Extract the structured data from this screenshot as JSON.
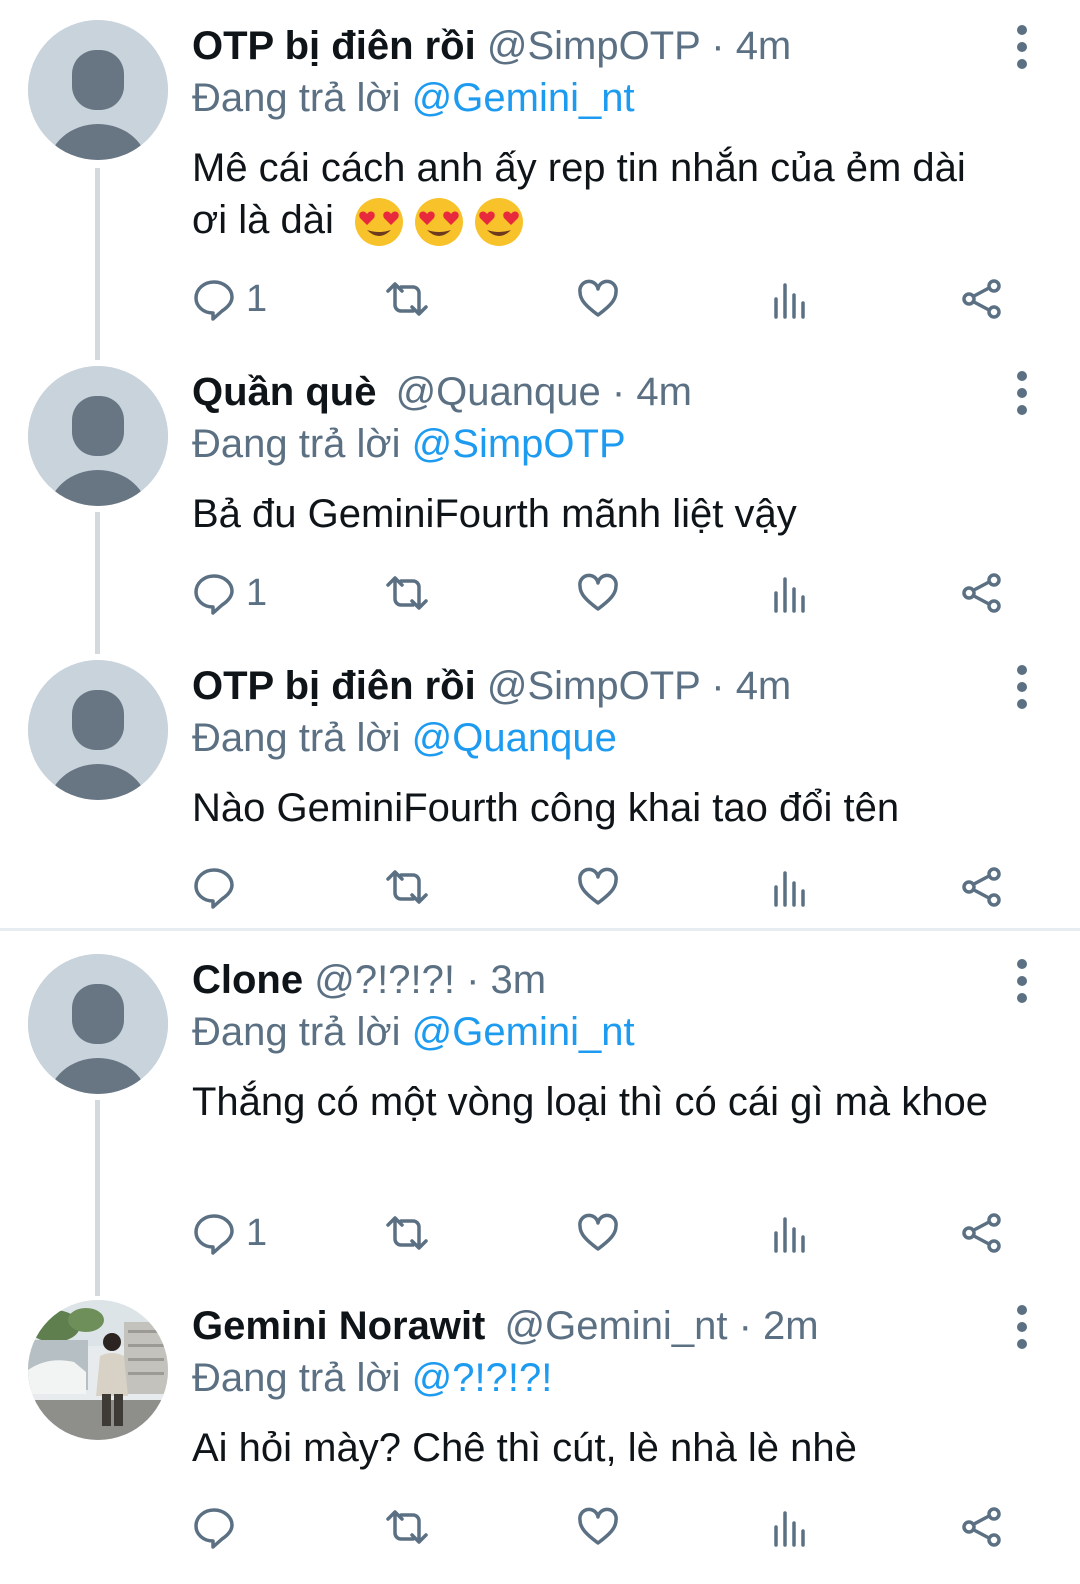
{
  "tweets": [
    {
      "name": "OTP bị điên rồi",
      "handle": "@SimpOTP",
      "time": "4m",
      "reply_prefix": "Đang trả lời",
      "reply_to": "@Gemini_nt",
      "body": "Mê cái cách anh ấy rep tin nhắn của ẻm dài ơi là dài",
      "reply_count": "1"
    },
    {
      "name": "Quần què",
      "handle": "@Quanque",
      "time": "4m",
      "reply_prefix": "Đang trả lời",
      "reply_to": "@SimpOTP",
      "body": "Bả đu GeminiFourth mãnh liệt vậy",
      "reply_count": "1"
    },
    {
      "name": "OTP bị điên rồi",
      "handle": "@SimpOTP",
      "time": "4m",
      "reply_prefix": "Đang trả lời",
      "reply_to": "@Quanque",
      "body": "Nào GeminiFourth công khai tao đổi tên",
      "reply_count": ""
    },
    {
      "name": "Clone",
      "handle": "@?!?!?!",
      "time": "3m",
      "reply_prefix": "Đang trả lời",
      "reply_to": "@Gemini_nt",
      "body": "Thắng có một vòng loại thì có cái gì mà khoe",
      "reply_count": "1"
    },
    {
      "name": "Gemini Norawit",
      "handle": "@Gemini_nt",
      "time": "2m",
      "reply_prefix": "Đang trả lời",
      "reply_to": "@?!?!?!",
      "body": "Ai hỏi mày? Chê thì cút, lè nhà lè nhè",
      "reply_count": ""
    }
  ],
  "separator": "·",
  "icons": {
    "reply": "reply-icon",
    "retweet": "retweet-icon",
    "like": "heart-icon",
    "views": "analytics-icon",
    "share": "share-icon",
    "more": "more-vertical-icon",
    "emoji": "heart-eyes-emoji"
  },
  "colors": {
    "text": "#0f1419",
    "secondary": "#5b7083",
    "link": "#1d9bf0",
    "avatar_bg": "#c9d3dc",
    "avatar_figure": "#687684"
  }
}
